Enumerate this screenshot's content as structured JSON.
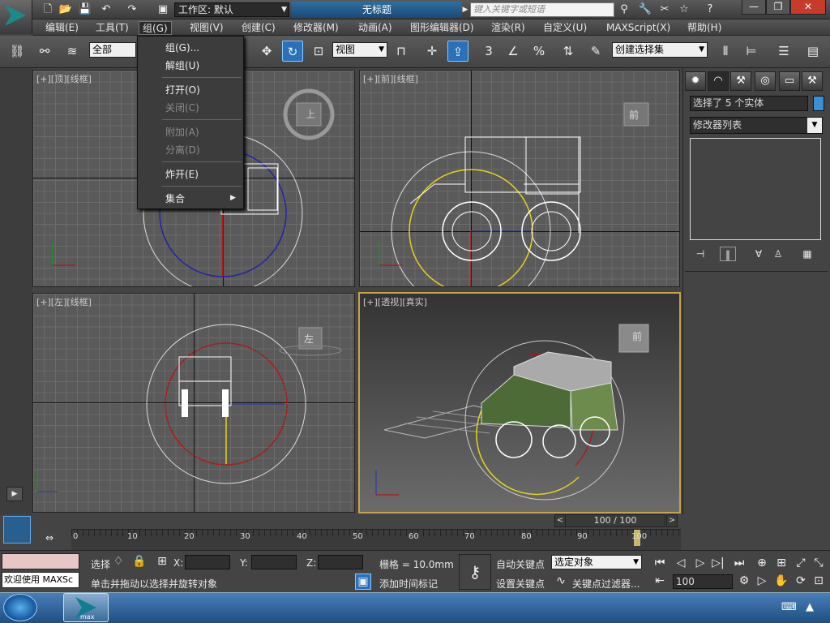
{
  "titlebar": {
    "workspace": "工作区: 默认",
    "document_title": "无标题",
    "search_placeholder": "键入关键字或短语",
    "qat_icons": [
      "new-file-icon",
      "open-folder-icon",
      "save-icon",
      "undo-icon",
      "redo-icon",
      "project-folder-icon"
    ],
    "help_icons": [
      "binoculars-icon",
      "wrench-icon",
      "exchange-icon",
      "star-icon",
      "help-icon"
    ],
    "window_controls": {
      "minimize": "—",
      "restore": "❐",
      "close": "✕"
    }
  },
  "menubar": {
    "items": [
      "编辑(E)",
      "工具(T)",
      "组(G)",
      "视图(V)",
      "创建(C)",
      "修改器(M)",
      "动画(A)",
      "图形编辑器(D)",
      "渲染(R)",
      "自定义(U)",
      "MAXScript(X)",
      "帮助(H)"
    ],
    "active": "组(G)"
  },
  "toolbar": {
    "selection_filter": "全部",
    "ref_coord": "视图",
    "named_selection": "创建选择集",
    "snap_labels": {
      "snap": "3",
      "percent": "%"
    }
  },
  "context_menu": {
    "items": [
      {
        "label": "组(G)...",
        "enabled": true
      },
      {
        "label": "解组(U)",
        "enabled": true
      },
      {
        "label": "打开(O)",
        "enabled": true
      },
      {
        "label": "关闭(C)",
        "enabled": false
      },
      {
        "label": "附加(A)",
        "enabled": false
      },
      {
        "label": "分离(D)",
        "enabled": false
      },
      {
        "label": "炸开(E)",
        "enabled": true
      },
      {
        "label": "集合",
        "enabled": true,
        "submenu": true
      }
    ]
  },
  "viewports": {
    "top": {
      "label": "[+][顶][线框]",
      "cube_label": "上"
    },
    "front": {
      "label": "[+][前][线框]",
      "cube_label": "前"
    },
    "left": {
      "label": "[+][左][线框]",
      "cube_label": "左"
    },
    "perspective": {
      "label": "[+][透视][真实]",
      "cube_label": "前"
    },
    "axis_labels": {
      "x": "x",
      "y": "y",
      "z": "z"
    }
  },
  "command_panel": {
    "tabs": [
      "create-icon",
      "modify-icon",
      "hierarchy-icon",
      "motion-icon",
      "display-icon",
      "utilities-icon"
    ],
    "selection_name": "选择了 5 个实体",
    "selection_color": "#3a8fd6",
    "modifier_list": "修改器列表"
  },
  "timeline": {
    "slider_text": "100 / 100",
    "ticks": [
      "0",
      "10",
      "20",
      "30",
      "40",
      "50",
      "60",
      "70",
      "80",
      "90",
      "100"
    ]
  },
  "status": {
    "maxscript_listener": "欢迎使用 MAXSc",
    "selection_status": "选择",
    "x_label": "X:",
    "y_label": "Y:",
    "z_label": "Z:",
    "x_value": "",
    "y_value": "",
    "z_value": "",
    "grid": "栅格 = 10.0mm",
    "prompt": "单击并拖动以选择并旋转对象",
    "add_time_tag": "添加时间标记",
    "auto_key": "自动关键点",
    "set_key": "设置关键点",
    "key_mode": "选定对象",
    "key_filters": "关键点过滤器...",
    "frame": "100"
  },
  "taskbar": {
    "app_label": "max"
  }
}
